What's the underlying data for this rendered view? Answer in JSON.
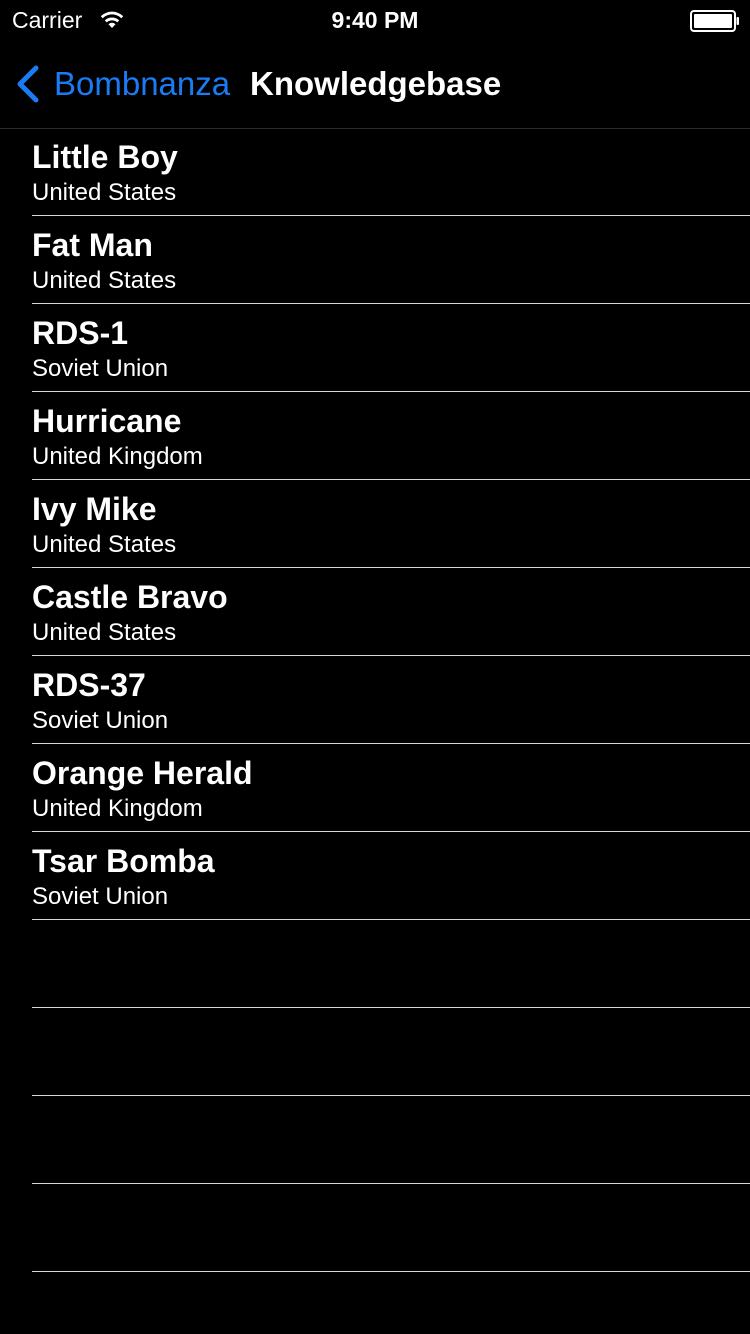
{
  "status_bar": {
    "carrier": "Carrier",
    "time": "9:40 PM",
    "wifi_icon": "wifi-icon",
    "battery_icon": "battery-icon"
  },
  "nav": {
    "back_label": "Bombnanza",
    "title": "Knowledgebase",
    "back_icon": "chevron-left-icon",
    "accent_color": "#1a7cf5"
  },
  "items": [
    {
      "title": "Little Boy",
      "subtitle": "United States"
    },
    {
      "title": "Fat Man",
      "subtitle": "United States"
    },
    {
      "title": "RDS-1",
      "subtitle": "Soviet Union"
    },
    {
      "title": "Hurricane",
      "subtitle": "United Kingdom"
    },
    {
      "title": "Ivy Mike",
      "subtitle": "United States"
    },
    {
      "title": "Castle Bravo",
      "subtitle": "United States"
    },
    {
      "title": "RDS-37",
      "subtitle": "Soviet Union"
    },
    {
      "title": "Orange Herald",
      "subtitle": "United Kingdom"
    },
    {
      "title": "Tsar Bomba",
      "subtitle": "Soviet Union"
    }
  ]
}
